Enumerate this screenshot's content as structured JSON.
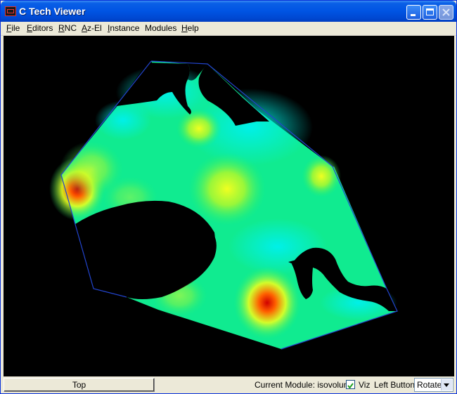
{
  "window": {
    "title": "C Tech Viewer"
  },
  "menu": {
    "items": [
      {
        "label": "File",
        "key": "F",
        "rest": "ile"
      },
      {
        "label": "Editors",
        "key": "E",
        "rest": "ditors"
      },
      {
        "label": "RNC",
        "key": "R",
        "rest": "NC"
      },
      {
        "label": "Az-El",
        "key": "A",
        "rest": "z-El"
      },
      {
        "label": "Instance",
        "key": "I",
        "rest": "nstance"
      },
      {
        "label": "Modules",
        "key": "",
        "rest": "Modules"
      },
      {
        "label": "Help",
        "key": "H",
        "rest": "elp"
      }
    ]
  },
  "status": {
    "view_button": "Top",
    "module_label": "Current Module: isovolume",
    "viz_checked": true,
    "viz_label": "Viz",
    "left_button_label": "Left Button",
    "mode_value": "Rotate"
  },
  "colors": {
    "titlebar": "#0054e3",
    "viewport_bg": "#000000",
    "boundary": "#2244cc",
    "surface_low": "#00e8e0",
    "surface_mid": "#22f070",
    "surface_high": "#e8ff20",
    "surface_peak": "#ff2000"
  }
}
